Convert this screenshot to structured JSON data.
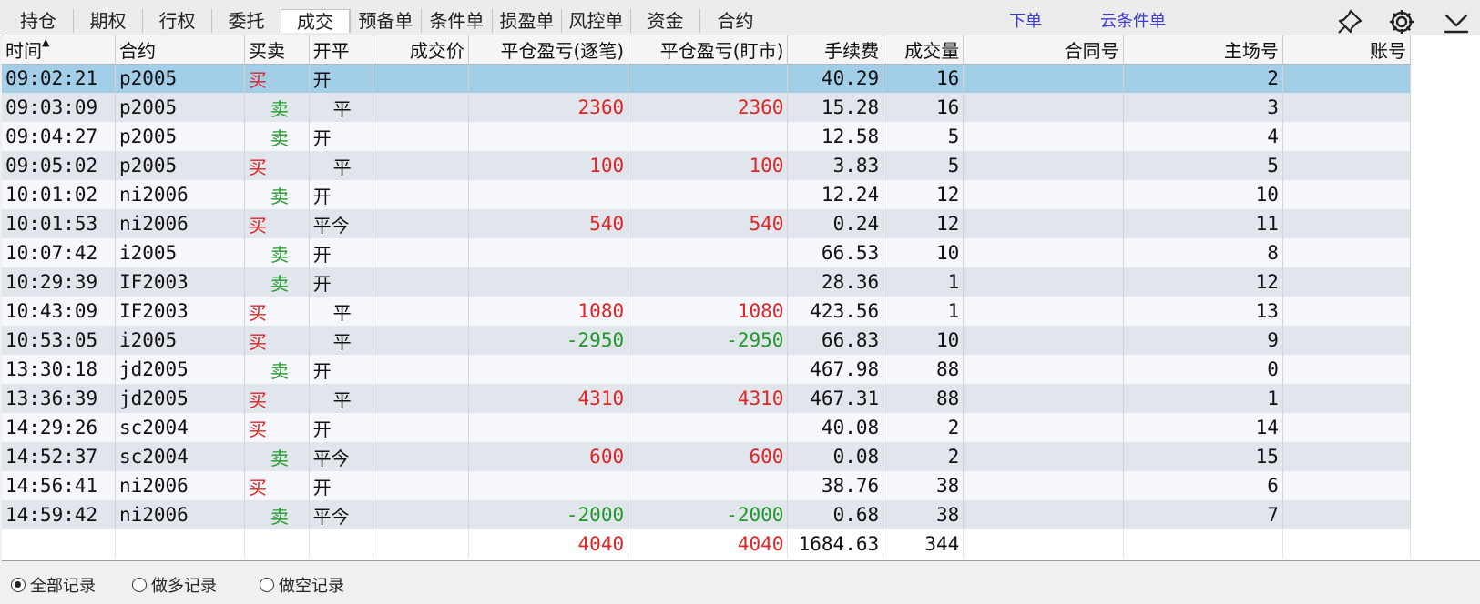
{
  "tabs": [
    {
      "label": "持仓",
      "width": 76
    },
    {
      "label": "期权",
      "width": 76
    },
    {
      "label": "行权",
      "width": 76
    },
    {
      "label": "委托",
      "width": 76
    },
    {
      "label": "成交",
      "width": 76,
      "active": true
    },
    {
      "label": "预备单",
      "width": 78
    },
    {
      "label": "条件单",
      "width": 78
    },
    {
      "label": "损盈单",
      "width": 76
    },
    {
      "label": "风控单",
      "width": 76
    },
    {
      "label": "资金",
      "width": 76
    },
    {
      "label": "合约",
      "width": 78
    }
  ],
  "toplinks": {
    "order": "下单",
    "cloud_condition": "云条件单"
  },
  "icons": {
    "pin": "pin-icon",
    "settings": "gear-icon",
    "collapse": "collapse-down-icon"
  },
  "columns": [
    {
      "label": "时间",
      "sort": "▲",
      "align": "left",
      "width": 120
    },
    {
      "label": "合约",
      "align": "left",
      "width": 137
    },
    {
      "label": "买卖",
      "align": "left",
      "width": 68
    },
    {
      "label": "开平",
      "align": "left",
      "width": 68
    },
    {
      "label": "成交价",
      "align": "right",
      "width": 101
    },
    {
      "label": "平仓盈亏(逐笔)",
      "align": "right",
      "width": 169
    },
    {
      "label": "平仓盈亏(盯市)",
      "align": "right",
      "width": 169
    },
    {
      "label": "手续费",
      "align": "right",
      "width": 101
    },
    {
      "label": "成交量",
      "align": "right",
      "width": 85
    },
    {
      "label": "合同号",
      "align": "right",
      "width": 169
    },
    {
      "label": "主场号",
      "align": "right",
      "width": 169
    },
    {
      "label": "账号",
      "align": "right",
      "width": 135
    }
  ],
  "rows": [
    {
      "time": "09:02:21",
      "contract": "p2005",
      "side": "买",
      "oc": "开",
      "price": "",
      "pnl_trade": "",
      "pnl_mtm": "",
      "fee": "40.29",
      "qty": "16",
      "contract_no": "",
      "seat": "2",
      "account": ""
    },
    {
      "time": "09:03:09",
      "contract": "p2005",
      "side": "卖",
      "oc": "平",
      "price": "",
      "pnl_trade": "2360",
      "pnl_mtm": "2360",
      "fee": "15.28",
      "qty": "16",
      "contract_no": "",
      "seat": "3",
      "account": ""
    },
    {
      "time": "09:04:27",
      "contract": "p2005",
      "side": "卖",
      "oc": "开",
      "price": "",
      "pnl_trade": "",
      "pnl_mtm": "",
      "fee": "12.58",
      "qty": "5",
      "contract_no": "",
      "seat": "4",
      "account": ""
    },
    {
      "time": "09:05:02",
      "contract": "p2005",
      "side": "买",
      "oc": "平",
      "price": "",
      "pnl_trade": "100",
      "pnl_mtm": "100",
      "fee": "3.83",
      "qty": "5",
      "contract_no": "",
      "seat": "5",
      "account": ""
    },
    {
      "time": "10:01:02",
      "contract": "ni2006",
      "side": "卖",
      "oc": "开",
      "price": "",
      "pnl_trade": "",
      "pnl_mtm": "",
      "fee": "12.24",
      "qty": "12",
      "contract_no": "",
      "seat": "10",
      "account": ""
    },
    {
      "time": "10:01:53",
      "contract": "ni2006",
      "side": "买",
      "oc": "平今",
      "price": "",
      "pnl_trade": "540",
      "pnl_mtm": "540",
      "fee": "0.24",
      "qty": "12",
      "contract_no": "",
      "seat": "11",
      "account": ""
    },
    {
      "time": "10:07:42",
      "contract": "i2005",
      "side": "卖",
      "oc": "开",
      "price": "",
      "pnl_trade": "",
      "pnl_mtm": "",
      "fee": "66.53",
      "qty": "10",
      "contract_no": "",
      "seat": "8",
      "account": ""
    },
    {
      "time": "10:29:39",
      "contract": "IF2003",
      "side": "卖",
      "oc": "开",
      "price": "",
      "pnl_trade": "",
      "pnl_mtm": "",
      "fee": "28.36",
      "qty": "1",
      "contract_no": "",
      "seat": "12",
      "account": ""
    },
    {
      "time": "10:43:09",
      "contract": "IF2003",
      "side": "买",
      "oc": "平",
      "price": "",
      "pnl_trade": "1080",
      "pnl_mtm": "1080",
      "fee": "423.56",
      "qty": "1",
      "contract_no": "",
      "seat": "13",
      "account": ""
    },
    {
      "time": "10:53:05",
      "contract": "i2005",
      "side": "买",
      "oc": "平",
      "price": "",
      "pnl_trade": "-2950",
      "pnl_mtm": "-2950",
      "fee": "66.83",
      "qty": "10",
      "contract_no": "",
      "seat": "9",
      "account": ""
    },
    {
      "time": "13:30:18",
      "contract": "jd2005",
      "side": "卖",
      "oc": "开",
      "price": "",
      "pnl_trade": "",
      "pnl_mtm": "",
      "fee": "467.98",
      "qty": "88",
      "contract_no": "",
      "seat": "0",
      "account": ""
    },
    {
      "time": "13:36:39",
      "contract": "jd2005",
      "side": "买",
      "oc": "平",
      "price": "",
      "pnl_trade": "4310",
      "pnl_mtm": "4310",
      "fee": "467.31",
      "qty": "88",
      "contract_no": "",
      "seat": "1",
      "account": ""
    },
    {
      "time": "14:29:26",
      "contract": "sc2004",
      "side": "买",
      "oc": "开",
      "price": "",
      "pnl_trade": "",
      "pnl_mtm": "",
      "fee": "40.08",
      "qty": "2",
      "contract_no": "",
      "seat": "14",
      "account": ""
    },
    {
      "time": "14:52:37",
      "contract": "sc2004",
      "side": "卖",
      "oc": "平今",
      "price": "",
      "pnl_trade": "600",
      "pnl_mtm": "600",
      "fee": "0.08",
      "qty": "2",
      "contract_no": "",
      "seat": "15",
      "account": ""
    },
    {
      "time": "14:56:41",
      "contract": "ni2006",
      "side": "买",
      "oc": "开",
      "price": "",
      "pnl_trade": "",
      "pnl_mtm": "",
      "fee": "38.76",
      "qty": "38",
      "contract_no": "",
      "seat": "6",
      "account": ""
    },
    {
      "time": "14:59:42",
      "contract": "ni2006",
      "side": "卖",
      "oc": "平今",
      "price": "",
      "pnl_trade": "-2000",
      "pnl_mtm": "-2000",
      "fee": "0.68",
      "qty": "38",
      "contract_no": "",
      "seat": "7",
      "account": ""
    }
  ],
  "selected_row": 0,
  "totals": {
    "pnl_trade": "4040",
    "pnl_mtm": "4040",
    "fee": "1684.63",
    "qty": "344"
  },
  "filters": [
    {
      "label": "全部记录",
      "checked": true
    },
    {
      "label": "做多记录",
      "checked": false
    },
    {
      "label": "做空记录",
      "checked": false
    }
  ],
  "colors": {
    "buy": "#e02424",
    "sell": "#1f9a2a",
    "link": "#3a3ad6",
    "selected": "#a2cee8",
    "row_odd": "#f5f7fd",
    "row_even": "#e1e5ec"
  }
}
